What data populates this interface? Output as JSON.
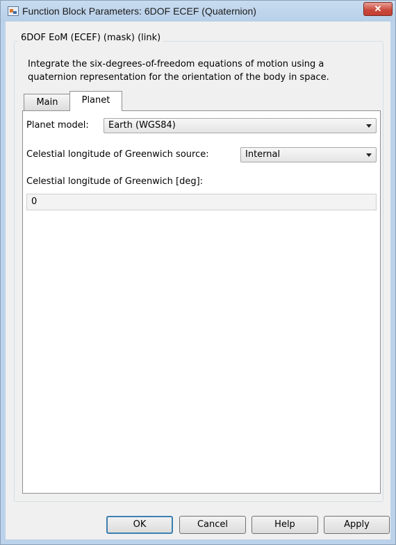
{
  "window": {
    "title": "Function Block Parameters: 6DOF ECEF (Quaternion)",
    "close_label": "✕"
  },
  "group": {
    "title": "6DOF EoM (ECEF) (mask) (link)",
    "description": "Integrate the six-degrees-of-freedom equations of motion using a quaternion representation for the orientation of the body in space."
  },
  "tabs": [
    {
      "label": "Main",
      "selected": false
    },
    {
      "label": "Planet",
      "selected": true
    }
  ],
  "planet_tab": {
    "planet_model_label": "Planet model:",
    "planet_model_value": "Earth (WGS84)",
    "greenwich_source_label": "Celestial longitude of Greenwich source:",
    "greenwich_source_value": "Internal",
    "greenwich_deg_label": "Celestial longitude of Greenwich [deg]:",
    "greenwich_deg_value": "0"
  },
  "buttons": {
    "ok": "OK",
    "cancel": "Cancel",
    "help": "Help",
    "apply": "Apply"
  },
  "colors": {
    "titlebar": "#bcd2ea",
    "close_button": "#c9463a",
    "default_button_border": "#3c7fb1"
  },
  "icons": {
    "app": "simulink-block-icon",
    "close": "close-icon",
    "dropdown": "chevron-down-icon"
  }
}
